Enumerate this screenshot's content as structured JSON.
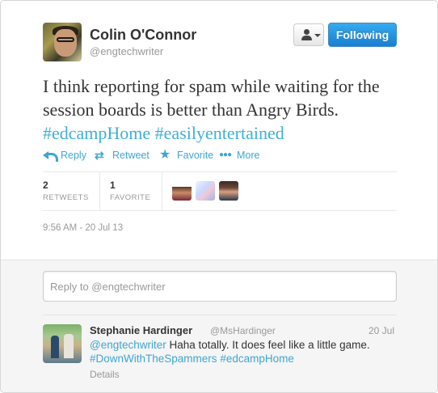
{
  "author": {
    "name": "Colin O'Connor",
    "handle": "@engtechwriter"
  },
  "header": {
    "follow_label": "Following",
    "user_menu_icon": "person-caret-icon"
  },
  "tweet": {
    "text": "I think reporting for spam while waiting for the session boards is better than Angry Birds.",
    "hashtag1": "#edcampHome",
    "hashtag2": "#easilyentertained"
  },
  "actions": {
    "reply": "Reply",
    "retweet": "Retweet",
    "favorite": "Favorite",
    "more": "More"
  },
  "stats": {
    "retweets_count": "2",
    "retweets_label": "RETWEETS",
    "favorites_count": "1",
    "favorites_label": "FAVORITE"
  },
  "timestamp": "9:56 AM - 20 Jul 13",
  "reply_box": {
    "placeholder": "Reply to @engtechwriter"
  },
  "reply": {
    "name": "Stephanie Hardinger",
    "handle": "@MsHardinger",
    "date": "20 Jul",
    "mention": "@engtechwriter",
    "text_line1": "Haha totally.  It does feel like a little game.",
    "hashtag1": "#DownWithTheSpammers",
    "hashtag2": "#edcampHome",
    "details": "Details"
  },
  "colors": {
    "link": "#3fa6d2",
    "follow_button": "#1f8fe0",
    "footer_bg": "#f5f5f5"
  }
}
